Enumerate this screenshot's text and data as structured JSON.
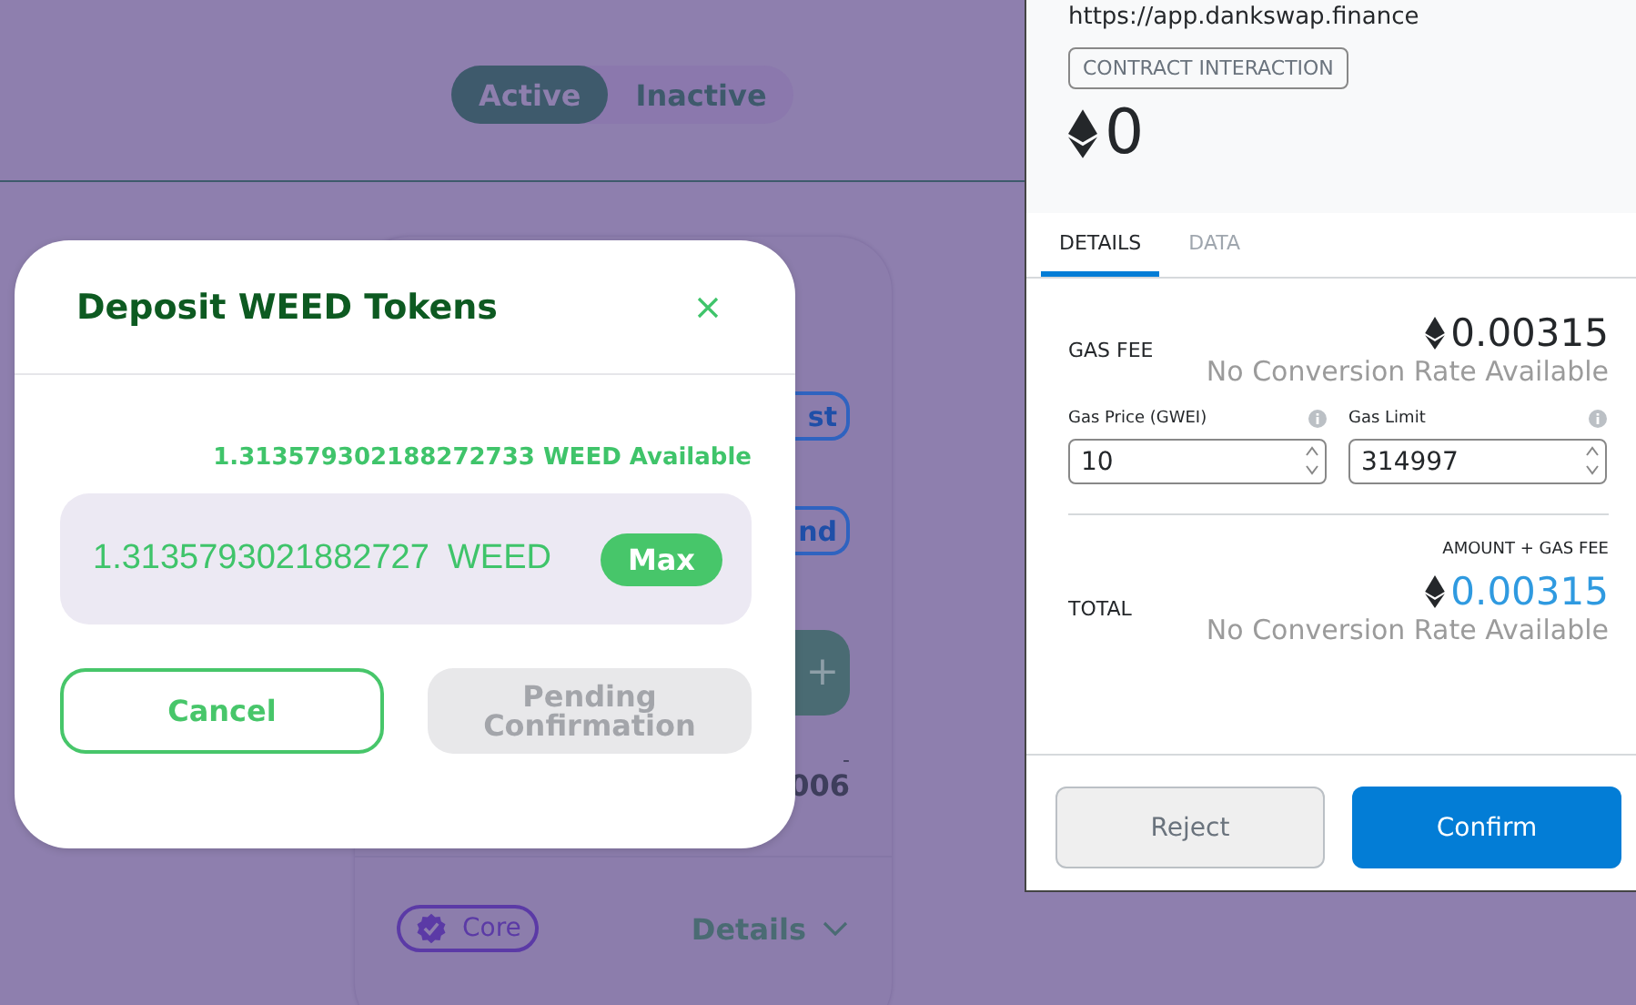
{
  "filter_tabs": [
    {
      "label": "Active",
      "selected": true
    },
    {
      "label": "Inactive",
      "selected": false
    }
  ],
  "pool_card": {
    "fragments": [
      {
        "kind": "outline_button",
        "text": "st"
      },
      {
        "kind": "outline_button",
        "text": "nd"
      },
      {
        "kind": "icon_button",
        "text": "+"
      },
      {
        "kind": "text",
        "text": "-"
      },
      {
        "kind": "value",
        "text": "006"
      }
    ],
    "badge": "Core",
    "details_label": "Details"
  },
  "deposit_modal": {
    "title": "Deposit WEED Tokens",
    "available": "1.313579302188272733 WEED Available",
    "amount": "1.3135793021882727",
    "unit": "WEED",
    "max_button": "Max",
    "buttons": [
      {
        "label": "Cancel",
        "disabled": false
      },
      {
        "label": "Pending Confirmation",
        "disabled": true
      }
    ]
  },
  "wallet": {
    "origin": "https://app.dankswap.finance",
    "tag": "CONTRACT INTERACTION",
    "amount": "0",
    "tabs": [
      {
        "label": "DETAILS",
        "selected": true
      },
      {
        "label": "DATA",
        "selected": false
      }
    ],
    "gas_fee": {
      "label": "GAS FEE",
      "value": "0.00315",
      "conversion": "No Conversion Rate Available"
    },
    "fields": [
      {
        "label": "Gas Price (GWEI)",
        "value": "10"
      },
      {
        "label": "Gas Limit",
        "value": "314997"
      }
    ],
    "total": {
      "hint": "AMOUNT + GAS FEE",
      "label": "TOTAL",
      "value": "0.00315",
      "conversion": "No Conversion Rate Available"
    },
    "buttons": [
      {
        "label": "Reject",
        "kind": "secondary"
      },
      {
        "label": "Confirm",
        "kind": "primary"
      }
    ]
  }
}
